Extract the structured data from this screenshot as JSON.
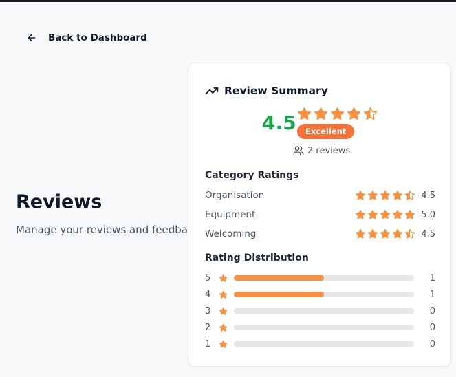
{
  "nav": {
    "back_label": "Back to Dashboard"
  },
  "page": {
    "title": "Reviews",
    "subtitle": "Manage your reviews and feedback"
  },
  "summary": {
    "title": "Review Summary",
    "score": "4.5",
    "rating": 4.5,
    "badge": "Excellent",
    "review_count": "2 reviews"
  },
  "categories": {
    "title": "Category Ratings",
    "items": [
      {
        "label": "Organisation",
        "rating": 4.5,
        "value": "4.5"
      },
      {
        "label": "Equipment",
        "rating": 5.0,
        "value": "5.0"
      },
      {
        "label": "Welcoming",
        "rating": 4.5,
        "value": "4.5"
      }
    ]
  },
  "distribution": {
    "title": "Rating Distribution",
    "rows": [
      {
        "stars": "5",
        "count": "1",
        "fraction": 0.5
      },
      {
        "stars": "4",
        "count": "1",
        "fraction": 0.5
      },
      {
        "stars": "3",
        "count": "0",
        "fraction": 0
      },
      {
        "stars": "2",
        "count": "0",
        "fraction": 0
      },
      {
        "stars": "1",
        "count": "0",
        "fraction": 0
      }
    ]
  },
  "colors": {
    "star": "#f59140",
    "score": "#16a34a",
    "badge": "#f4733b",
    "bar_fill": "#f59140",
    "bar_track": "#e5e7eb"
  }
}
